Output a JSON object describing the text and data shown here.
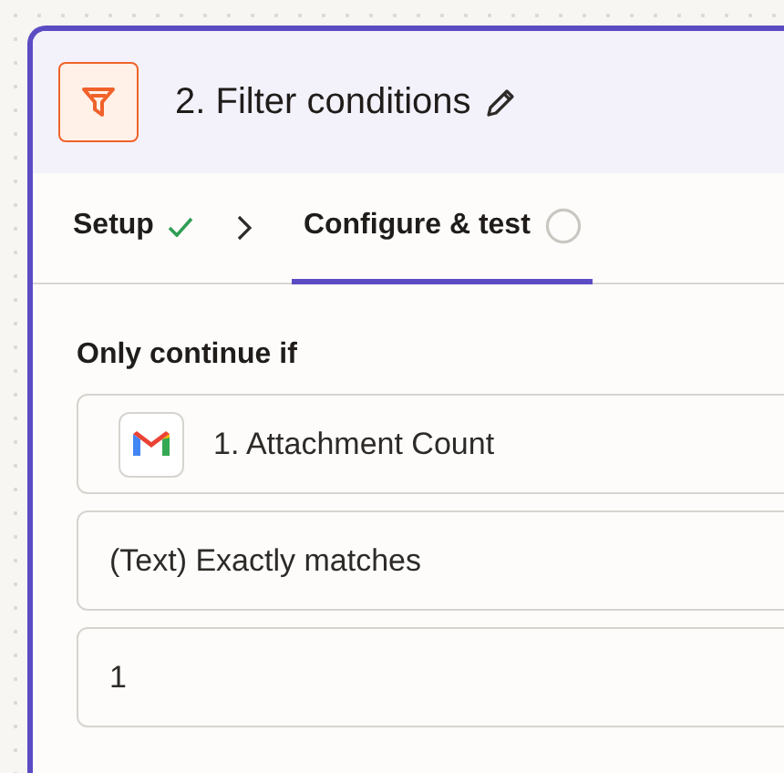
{
  "step": {
    "title": "2. Filter conditions"
  },
  "tabs": [
    {
      "label": "Setup",
      "selected": false,
      "completed": true
    },
    {
      "label": "Configure & test",
      "selected": true,
      "completed": false
    }
  ],
  "rule": {
    "heading": "Only continue if",
    "fields": [
      {
        "kind": "source",
        "value": "1. Attachment Count"
      },
      {
        "kind": "select",
        "value": "(Text) Exactly matches"
      },
      {
        "kind": "input",
        "value": "1"
      }
    ]
  }
}
